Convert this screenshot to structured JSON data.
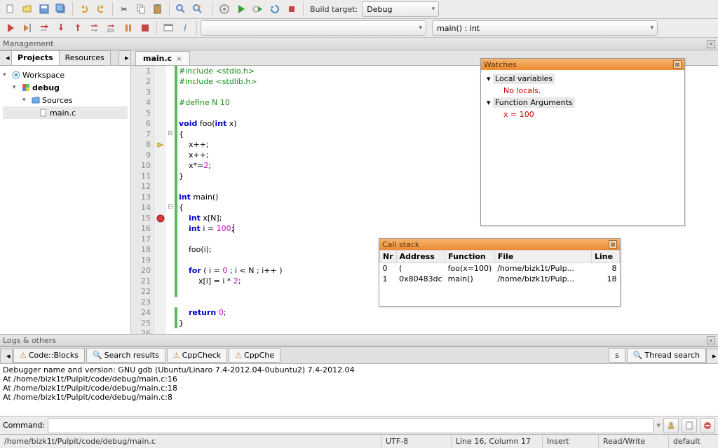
{
  "toolbar": {
    "build_target_label": "Build target:",
    "build_target_value": "Debug",
    "scope_value": "main() : int"
  },
  "sidebar": {
    "title": "Management",
    "tabs": [
      "Projects",
      "Resources"
    ],
    "tree": {
      "workspace": "Workspace",
      "project": "debug",
      "folder": "Sources",
      "file": "main.c"
    }
  },
  "editor": {
    "file_tab": "main.c",
    "lines": [
      {
        "n": 1,
        "c": "green",
        "html": "<span class='pp'>#include &lt;stdio.h&gt;</span>"
      },
      {
        "n": 2,
        "c": "green",
        "html": "<span class='pp'>#include &lt;stdlib.h&gt;</span>"
      },
      {
        "n": 3,
        "c": "green",
        "html": ""
      },
      {
        "n": 4,
        "c": "green",
        "html": "<span class='pp'>#define N 10</span>"
      },
      {
        "n": 5,
        "c": "green",
        "html": ""
      },
      {
        "n": 6,
        "c": "green",
        "html": "<span class='kw'>void</span> foo(<span class='kw'>int</span> x)"
      },
      {
        "n": 7,
        "c": "green",
        "fold": "⊟",
        "html": "{"
      },
      {
        "n": 8,
        "c": "green",
        "mark": "arrow",
        "html": "    x++;"
      },
      {
        "n": 9,
        "c": "green",
        "html": "    x++;"
      },
      {
        "n": 10,
        "c": "green",
        "html": "    x*=<span class='num'>2</span>;"
      },
      {
        "n": 11,
        "c": "green",
        "html": "}"
      },
      {
        "n": 12,
        "c": "green",
        "html": ""
      },
      {
        "n": 13,
        "c": "green",
        "html": "<span class='kw'>int</span> main()"
      },
      {
        "n": 14,
        "c": "green",
        "fold": "⊟",
        "html": "{"
      },
      {
        "n": 15,
        "c": "green",
        "mark": "bp",
        "html": "    <span class='kw'>int</span> x[N];"
      },
      {
        "n": 16,
        "c": "green",
        "html": "    <span class='kw'>int</span> i = <span class='num'>100</span>;<span class='cursor'></span>"
      },
      {
        "n": 17,
        "c": "green",
        "html": ""
      },
      {
        "n": 18,
        "c": "green",
        "html": "    foo(i);"
      },
      {
        "n": 19,
        "c": "green",
        "html": ""
      },
      {
        "n": 20,
        "c": "green",
        "html": "    <span class='kw'>for</span> ( i = <span class='num'>0</span> ; i &lt; N ; i++ )"
      },
      {
        "n": 21,
        "c": "green",
        "html": "        x[i] = i * <span class='num'>2</span>;"
      },
      {
        "n": 22,
        "c": "green",
        "html": ""
      },
      {
        "n": 23,
        "c": "",
        "html": ""
      },
      {
        "n": 24,
        "c": "green",
        "html": "    <span class='kw'>return</span> <span class='num'>0</span>;"
      },
      {
        "n": 25,
        "c": "green",
        "html": "}"
      },
      {
        "n": 26,
        "c": "",
        "html": ""
      }
    ]
  },
  "watches": {
    "title": "Watches",
    "local_vars": "Local variables",
    "no_locals": "No locals.",
    "func_args": "Function Arguments",
    "arg1": "x = 100"
  },
  "callstack": {
    "title": "Call stack",
    "cols": [
      "Nr",
      "Address",
      "Function",
      "File",
      "Line"
    ],
    "rows": [
      [
        "0",
        "(",
        "foo(x=100)",
        "/home/bizk1t/Pulp...",
        "8"
      ],
      [
        "1",
        "0x80483dc",
        "main()",
        "/home/bizk1t/Pulp...",
        "18"
      ]
    ]
  },
  "logs": {
    "title": "Logs & others",
    "tabs": [
      "Code::Blocks",
      "Search results",
      "CppCheck",
      "CppChe",
      "s",
      "Thread search"
    ],
    "lines": [
      "Debugger name and version: GNU gdb (Ubuntu/Linaro 7.4-2012.04-0ubuntu2) 7.4-2012.04",
      "At /home/bizk1t/Pulpit/code/debug/main.c:16",
      "At /home/bizk1t/Pulpit/code/debug/main.c:18",
      "At /home/bizk1t/Pulpit/code/debug/main.c:8"
    ],
    "command_label": "Command:"
  },
  "statusbar": {
    "path": "/home/bizk1t/Pulpit/code/debug/main.c",
    "encoding": "UTF-8",
    "position": "Line 16, Column 17",
    "insert": "Insert",
    "rw": "Read/Write",
    "profile": "default"
  }
}
